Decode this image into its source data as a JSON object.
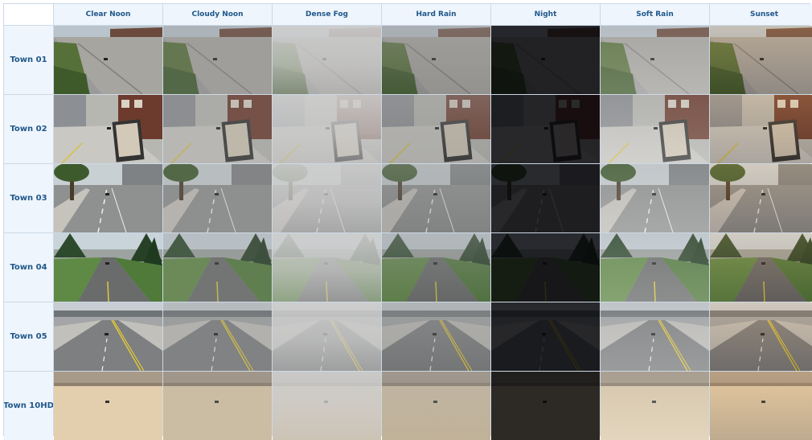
{
  "columns": [
    "Clear Noon",
    "Cloudy Noon",
    "Dense Fog",
    "Hard Rain",
    "Night",
    "Soft Rain",
    "Sunset"
  ],
  "rows": [
    "Town 01",
    "Town 02",
    "Town 03",
    "Town 04",
    "Town 05",
    "Town 10HD"
  ],
  "colors": {
    "header_bg": "#eef5fc",
    "header_text": "#20578a",
    "grid_line": "#cdd9e6"
  }
}
